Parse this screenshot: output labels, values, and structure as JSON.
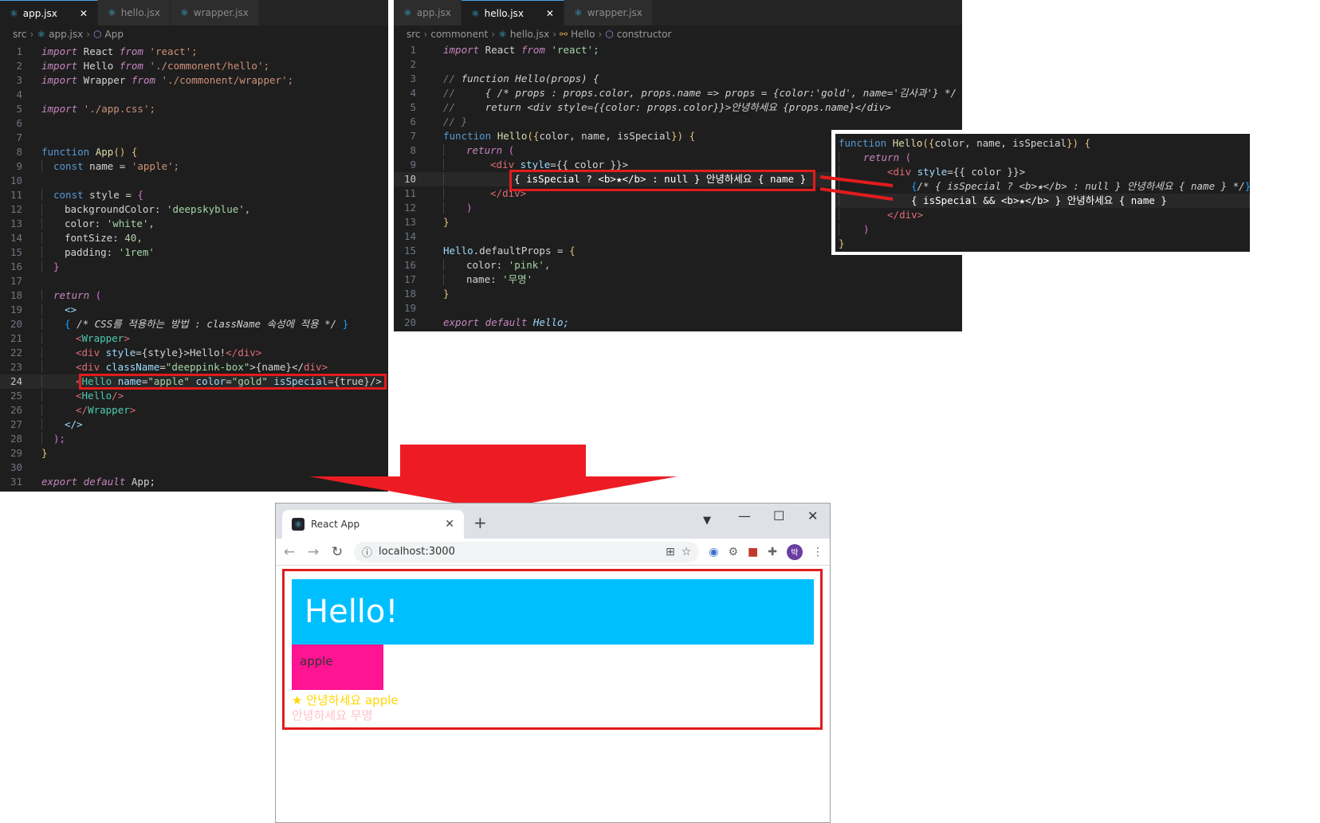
{
  "left_editor": {
    "tabs": [
      {
        "label": "app.jsx",
        "active": true
      },
      {
        "label": "hello.jsx",
        "active": false
      },
      {
        "label": "wrapper.jsx",
        "active": false
      }
    ],
    "breadcrumb": [
      "src",
      "app.jsx",
      "App"
    ],
    "current_line": "24",
    "line_numbers": [
      "1",
      "2",
      "3",
      "4",
      "5",
      "6",
      "7",
      "8",
      "9",
      "10",
      "11",
      "12",
      "13",
      "14",
      "15",
      "16",
      "17",
      "18",
      "19",
      "20",
      "21",
      "22",
      "23",
      "24",
      "25",
      "26",
      "27",
      "28",
      "29",
      "30",
      "31"
    ],
    "code": {
      "l1_a": "import",
      "l1_b": " React ",
      "l1_c": "from",
      "l1_d": " 'react';",
      "l2_a": "import",
      "l2_b": " Hello ",
      "l2_c": "from",
      "l2_d": " './commonent/hello';",
      "l3_a": "import",
      "l3_b": " Wrapper ",
      "l3_c": "from",
      "l3_d": " './commonent/wrapper';",
      "l5_a": "import",
      "l5_b": " './app.css';",
      "l8_a": "function",
      "l8_b": " App",
      "l8_c": "() {",
      "l9_a": "const",
      "l9_b": " name = ",
      "l9_c": "'apple';",
      "l11_a": "const",
      "l11_b": " style = ",
      "l11_c": "{",
      "l12_a": "backgroundColor: ",
      "l12_b": "'deepskyblue',",
      "l13_a": "color: ",
      "l13_b": "'white',",
      "l14_a": "fontSize: ",
      "l14_b": "40,",
      "l15_a": "padding: ",
      "l15_b": "'1rem'",
      "l16_a": "}",
      "l18_a": "return",
      "l18_b": " (",
      "l19_a": "<>",
      "l20_a": "{ ",
      "l20_b": "/* CSS를 적용하는 방법 : className 속성에 적용 */",
      "l20_c": " }",
      "l21_a": "<",
      "l21_b": "Wrapper",
      "l21_c": ">",
      "l22_a": "<",
      "l22_b": "div",
      "l22_c": " style",
      "l22_d": "={style}>",
      "l22_e": "Hello!",
      "l22_f": "</",
      "l22_g": "div",
      "l22_h": ">",
      "l23_a": "<",
      "l23_b": "div",
      "l23_c": " className",
      "l23_d": "=",
      "l23_e": "\"deeppink-box\"",
      "l23_f": ">{name}</",
      "l23_g": "div",
      "l23_h": ">",
      "l24_a": "<",
      "l24_b": "Hello",
      "l24_c": " name",
      "l24_d": "=",
      "l24_e": "\"apple\"",
      "l24_f": " color",
      "l24_g": "=",
      "l24_h": "\"gold\"",
      "l24_i": " isSpecial",
      "l24_j": "={true}/>",
      "l25_a": "<",
      "l25_b": "Hello",
      "l25_c": "/>",
      "l26_a": "</",
      "l26_b": "Wrapper",
      "l26_c": ">",
      "l27_a": "</>",
      "l28_a": ");",
      "l29_a": "}",
      "l31_a": "export",
      "l31_b": " default",
      "l31_c": " App;"
    }
  },
  "right_editor": {
    "tabs": [
      {
        "label": "app.jsx",
        "active": false
      },
      {
        "label": "hello.jsx",
        "active": true
      },
      {
        "label": "wrapper.jsx",
        "active": false
      }
    ],
    "breadcrumb": [
      "src",
      "commonent",
      "hello.jsx",
      "Hello",
      "constructor"
    ],
    "current_line": "10",
    "line_numbers": [
      "1",
      "2",
      "3",
      "4",
      "5",
      "6",
      "7",
      "8",
      "9",
      "10",
      "11",
      "12",
      "13",
      "14",
      "15",
      "16",
      "17",
      "18",
      "19",
      "20"
    ],
    "code": {
      "l1_a": "import",
      "l1_b": " React ",
      "l1_c": "from",
      "l1_d": " 'react';",
      "l3_a": "// ",
      "l3_b": "function Hello(props) {",
      "l4_a": "//",
      "l4_b": "     { /* props : props.color, props.name => props = {color:'gold', name='김사과'} */ }",
      "l5_a": "//",
      "l5_b": "     return <div style={{color: props.color}}>안녕하세요 {props.name}</div>",
      "l6_a": "// }",
      "l7_a": "function",
      "l7_b": " Hello",
      "l7_c": "({",
      "l7_d": "color, name, isSpecial",
      "l7_e": "}) {",
      "l8_a": "return",
      "l8_b": " (",
      "l9_a": "<",
      "l9_b": "div",
      "l9_c": " style",
      "l9_d": "={{ color }}>",
      "l10_a": "{ ",
      "l10_b": "isSpecial",
      "l10_c": " ? ",
      "l10_d": "<b>★</b>",
      "l10_e": " : null } ",
      "l10_f": "안녕하세요",
      "l10_g": " { name }",
      "l11_a": "</",
      "l11_b": "div",
      "l11_c": ">",
      "l12_a": ")",
      "l13_a": "}",
      "l15_a": "Hello",
      "l15_b": ".defaultProps = ",
      "l15_c": "{",
      "l16_a": "color: ",
      "l16_b": "'pink',",
      "l17_a": "name: ",
      "l17_b": "'무명'",
      "l18_a": "}",
      "l20_a": "export",
      "l20_b": " default",
      "l20_c": " Hello;"
    }
  },
  "zoom_snippet": {
    "z1_a": "function",
    "z1_b": " Hello",
    "z1_c": "({",
    "z1_d": "color, name, isSpecial",
    "z1_e": "}) {",
    "z2_a": "return",
    "z2_b": " (",
    "z3_a": "<",
    "z3_b": "div",
    "z3_c": " style",
    "z3_d": "={{ color }}>",
    "z4_a": "{",
    "z4_b": "/* { isSpecial ? <b>★</b> : null } 안녕하세요 { name } */",
    "z4_c": "}",
    "z5_a": "{ isSpecial ",
    "z5_b": "&&",
    "z5_c": " <b>★</b> } ",
    "z5_d": "안녕하세요",
    "z5_e": " { name }",
    "z6_a": "</",
    "z6_b": "div",
    "z6_c": ">",
    "z7_a": ")",
    "z8_a": "}"
  },
  "browser": {
    "tab_title": "React App",
    "tab_close": "✕",
    "new_tab": "+",
    "address": "localhost:3000",
    "page": {
      "hello_text": "Hello!",
      "name_box_text": "apple",
      "special_star": "★",
      "greeting_special": " 안녕하세요 apple",
      "greeting_default": "안녕하세요 무명"
    },
    "avatar_letter": "박"
  },
  "colors": {
    "highlight": "#e21c1c",
    "arrow": "#ed1c24",
    "editor_bg": "#1e1e1e",
    "hello_bg": "deepskyblue",
    "name_box_bg": "deeppink",
    "special_text": "gold",
    "default_text": "pink"
  },
  "icons": [
    "react-file-icon",
    "close-icon",
    "chevron-right-icon",
    "cube-icon",
    "class-icon",
    "back-arrow-icon",
    "forward-arrow-icon",
    "reload-icon",
    "info-icon",
    "translate-icon",
    "star-icon",
    "extension-icon",
    "puzzle-icon",
    "menu-dots-icon",
    "minimize-icon",
    "maximize-icon",
    "window-close-icon",
    "profile-dropdown-icon",
    "down-arrow-icon"
  ]
}
